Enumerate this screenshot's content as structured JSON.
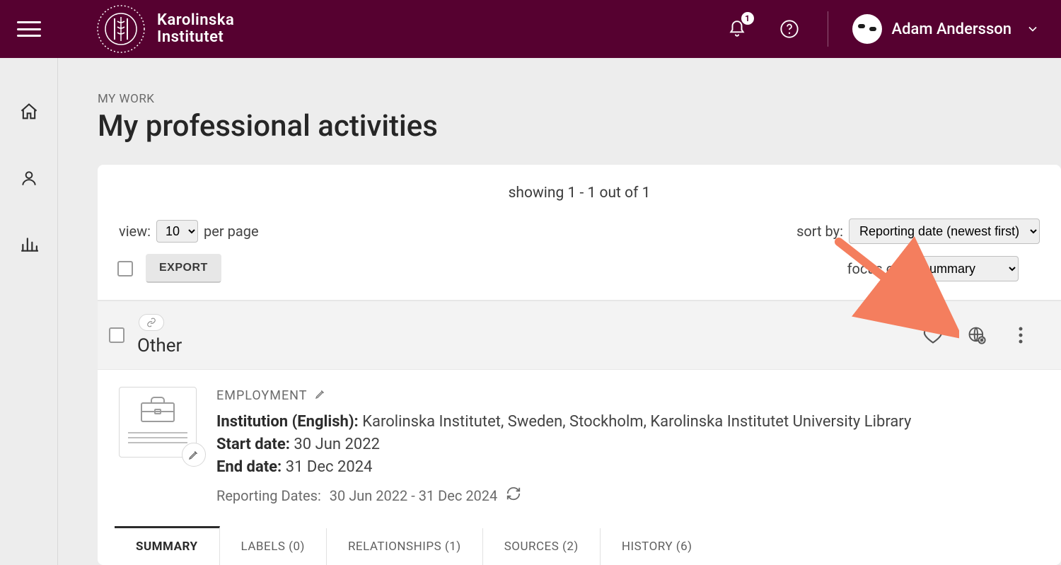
{
  "header": {
    "org_line1": "Karolinska",
    "org_line2": "Institutet",
    "notification_count": "1",
    "username": "Adam Andersson"
  },
  "sidebar": {
    "home": "home",
    "profile": "profile",
    "reports": "reports"
  },
  "breadcrumb": "MY WORK",
  "page_title": "My professional activities",
  "listing": {
    "showing_text": "showing 1 - 1 out of 1",
    "view_label": "view:",
    "view_value": "10",
    "per_page_suffix": "per page",
    "sort_label": "sort by:",
    "sort_value": "Reporting date (newest first)",
    "export_label": "EXPORT",
    "focus_label": "focus on:",
    "focus_value": "summary"
  },
  "card": {
    "title": "Other",
    "type_label": "EMPLOYMENT",
    "fields": {
      "institution_label": "Institution (English):",
      "institution_value": "Karolinska Institutet, Sweden, Stockholm, Karolinska Institutet University Library",
      "start_label": "Start date:",
      "start_value": "30 Jun 2022",
      "end_label": "End date:",
      "end_value": "31 Dec 2024"
    },
    "reporting_label": "Reporting Dates:",
    "reporting_value": "30 Jun 2022 - 31 Dec 2024",
    "tabs": [
      {
        "label": "SUMMARY",
        "active": true
      },
      {
        "label": "LABELS (0)"
      },
      {
        "label": "RELATIONSHIPS (1)"
      },
      {
        "label": "SOURCES (2)"
      },
      {
        "label": "HISTORY (6)"
      }
    ]
  },
  "annotation": {
    "arrow_color": "#f47e5e"
  }
}
